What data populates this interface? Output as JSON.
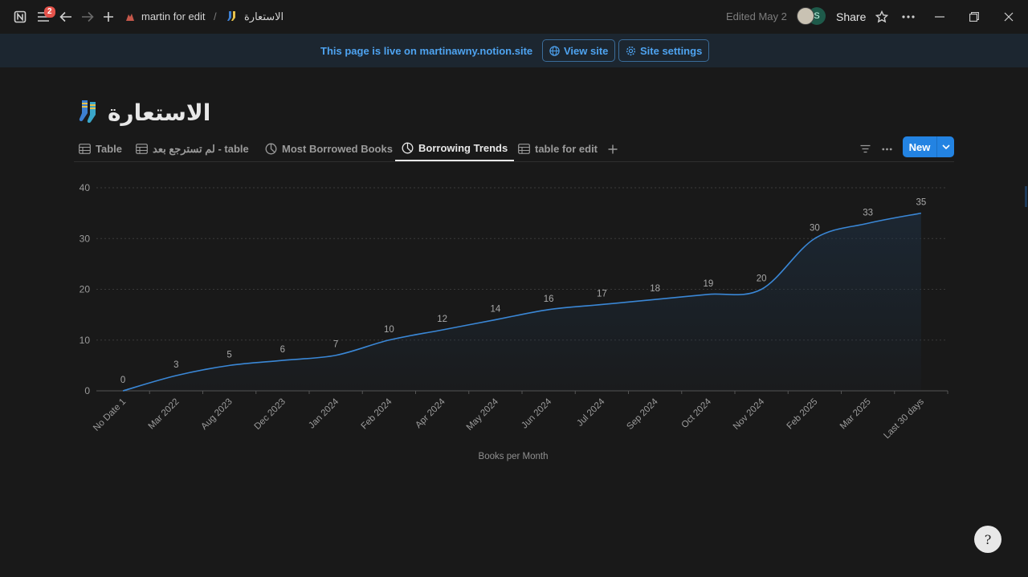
{
  "topbar": {
    "notification_count": "2",
    "workspace": "martin for edit",
    "separator": "/",
    "page": "الاستعارة",
    "edited": "Edited May 2",
    "avatar_letter": "S",
    "share": "Share"
  },
  "banner": {
    "text": "This page is live on martinawny.notion.site",
    "view_site": "View site",
    "site_settings": "Site settings"
  },
  "page": {
    "title": "الاستعارة",
    "icon": "socks-icon"
  },
  "tabs": [
    {
      "label": "Table",
      "icon": "table-icon"
    },
    {
      "label": "لم تسترجع بعد - table",
      "icon": "table-icon"
    },
    {
      "label": "Most Borrowed Books",
      "icon": "chart-icon"
    },
    {
      "label": "Borrowing Trends",
      "icon": "chart-icon",
      "active": true
    },
    {
      "label": "table for edit",
      "icon": "table-icon"
    }
  ],
  "toolbar": {
    "new_label": "New"
  },
  "colors": {
    "accent": "#2383e2",
    "line": "#3a87d6",
    "banner_text": "#4ea3f0"
  },
  "chart_data": {
    "type": "area",
    "categories": [
      "No Date 1",
      "Mar 2022",
      "Aug 2023",
      "Dec 2023",
      "Jan 2024",
      "Feb 2024",
      "Apr 2024",
      "May 2024",
      "Jun 2024",
      "Jul 2024",
      "Sep 2024",
      "Oct 2024",
      "Nov 2024",
      "Feb 2025",
      "Mar 2025",
      "Last 30 days"
    ],
    "values": [
      0,
      3,
      5,
      6,
      7,
      10,
      12,
      14,
      16,
      17,
      18,
      19,
      20,
      30,
      33,
      35
    ],
    "xlabel": "Books per Month",
    "ylabel": "",
    "ylim": [
      0,
      40
    ],
    "yticks": [
      0,
      10,
      20,
      30,
      40
    ],
    "grid": true,
    "cumulative": true
  },
  "help": {
    "symbol": "?"
  }
}
